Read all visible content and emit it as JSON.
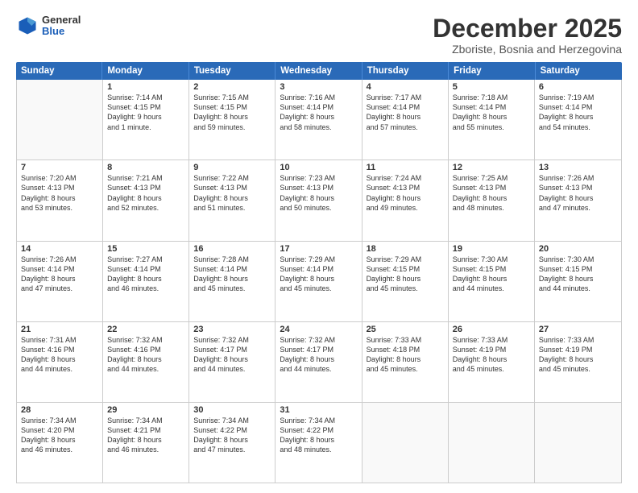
{
  "header": {
    "logo_general": "General",
    "logo_blue": "Blue",
    "main_title": "December 2025",
    "subtitle": "Zboriste, Bosnia and Herzegovina"
  },
  "days_of_week": [
    "Sunday",
    "Monday",
    "Tuesday",
    "Wednesday",
    "Thursday",
    "Friday",
    "Saturday"
  ],
  "weeks": [
    [
      {
        "day": "",
        "lines": []
      },
      {
        "day": "1",
        "lines": [
          "Sunrise: 7:14 AM",
          "Sunset: 4:15 PM",
          "Daylight: 9 hours",
          "and 1 minute."
        ]
      },
      {
        "day": "2",
        "lines": [
          "Sunrise: 7:15 AM",
          "Sunset: 4:15 PM",
          "Daylight: 8 hours",
          "and 59 minutes."
        ]
      },
      {
        "day": "3",
        "lines": [
          "Sunrise: 7:16 AM",
          "Sunset: 4:14 PM",
          "Daylight: 8 hours",
          "and 58 minutes."
        ]
      },
      {
        "day": "4",
        "lines": [
          "Sunrise: 7:17 AM",
          "Sunset: 4:14 PM",
          "Daylight: 8 hours",
          "and 57 minutes."
        ]
      },
      {
        "day": "5",
        "lines": [
          "Sunrise: 7:18 AM",
          "Sunset: 4:14 PM",
          "Daylight: 8 hours",
          "and 55 minutes."
        ]
      },
      {
        "day": "6",
        "lines": [
          "Sunrise: 7:19 AM",
          "Sunset: 4:14 PM",
          "Daylight: 8 hours",
          "and 54 minutes."
        ]
      }
    ],
    [
      {
        "day": "7",
        "lines": [
          "Sunrise: 7:20 AM",
          "Sunset: 4:13 PM",
          "Daylight: 8 hours",
          "and 53 minutes."
        ]
      },
      {
        "day": "8",
        "lines": [
          "Sunrise: 7:21 AM",
          "Sunset: 4:13 PM",
          "Daylight: 8 hours",
          "and 52 minutes."
        ]
      },
      {
        "day": "9",
        "lines": [
          "Sunrise: 7:22 AM",
          "Sunset: 4:13 PM",
          "Daylight: 8 hours",
          "and 51 minutes."
        ]
      },
      {
        "day": "10",
        "lines": [
          "Sunrise: 7:23 AM",
          "Sunset: 4:13 PM",
          "Daylight: 8 hours",
          "and 50 minutes."
        ]
      },
      {
        "day": "11",
        "lines": [
          "Sunrise: 7:24 AM",
          "Sunset: 4:13 PM",
          "Daylight: 8 hours",
          "and 49 minutes."
        ]
      },
      {
        "day": "12",
        "lines": [
          "Sunrise: 7:25 AM",
          "Sunset: 4:13 PM",
          "Daylight: 8 hours",
          "and 48 minutes."
        ]
      },
      {
        "day": "13",
        "lines": [
          "Sunrise: 7:26 AM",
          "Sunset: 4:13 PM",
          "Daylight: 8 hours",
          "and 47 minutes."
        ]
      }
    ],
    [
      {
        "day": "14",
        "lines": [
          "Sunrise: 7:26 AM",
          "Sunset: 4:14 PM",
          "Daylight: 8 hours",
          "and 47 minutes."
        ]
      },
      {
        "day": "15",
        "lines": [
          "Sunrise: 7:27 AM",
          "Sunset: 4:14 PM",
          "Daylight: 8 hours",
          "and 46 minutes."
        ]
      },
      {
        "day": "16",
        "lines": [
          "Sunrise: 7:28 AM",
          "Sunset: 4:14 PM",
          "Daylight: 8 hours",
          "and 45 minutes."
        ]
      },
      {
        "day": "17",
        "lines": [
          "Sunrise: 7:29 AM",
          "Sunset: 4:14 PM",
          "Daylight: 8 hours",
          "and 45 minutes."
        ]
      },
      {
        "day": "18",
        "lines": [
          "Sunrise: 7:29 AM",
          "Sunset: 4:15 PM",
          "Daylight: 8 hours",
          "and 45 minutes."
        ]
      },
      {
        "day": "19",
        "lines": [
          "Sunrise: 7:30 AM",
          "Sunset: 4:15 PM",
          "Daylight: 8 hours",
          "and 44 minutes."
        ]
      },
      {
        "day": "20",
        "lines": [
          "Sunrise: 7:30 AM",
          "Sunset: 4:15 PM",
          "Daylight: 8 hours",
          "and 44 minutes."
        ]
      }
    ],
    [
      {
        "day": "21",
        "lines": [
          "Sunrise: 7:31 AM",
          "Sunset: 4:16 PM",
          "Daylight: 8 hours",
          "and 44 minutes."
        ]
      },
      {
        "day": "22",
        "lines": [
          "Sunrise: 7:32 AM",
          "Sunset: 4:16 PM",
          "Daylight: 8 hours",
          "and 44 minutes."
        ]
      },
      {
        "day": "23",
        "lines": [
          "Sunrise: 7:32 AM",
          "Sunset: 4:17 PM",
          "Daylight: 8 hours",
          "and 44 minutes."
        ]
      },
      {
        "day": "24",
        "lines": [
          "Sunrise: 7:32 AM",
          "Sunset: 4:17 PM",
          "Daylight: 8 hours",
          "and 44 minutes."
        ]
      },
      {
        "day": "25",
        "lines": [
          "Sunrise: 7:33 AM",
          "Sunset: 4:18 PM",
          "Daylight: 8 hours",
          "and 45 minutes."
        ]
      },
      {
        "day": "26",
        "lines": [
          "Sunrise: 7:33 AM",
          "Sunset: 4:19 PM",
          "Daylight: 8 hours",
          "and 45 minutes."
        ]
      },
      {
        "day": "27",
        "lines": [
          "Sunrise: 7:33 AM",
          "Sunset: 4:19 PM",
          "Daylight: 8 hours",
          "and 45 minutes."
        ]
      }
    ],
    [
      {
        "day": "28",
        "lines": [
          "Sunrise: 7:34 AM",
          "Sunset: 4:20 PM",
          "Daylight: 8 hours",
          "and 46 minutes."
        ]
      },
      {
        "day": "29",
        "lines": [
          "Sunrise: 7:34 AM",
          "Sunset: 4:21 PM",
          "Daylight: 8 hours",
          "and 46 minutes."
        ]
      },
      {
        "day": "30",
        "lines": [
          "Sunrise: 7:34 AM",
          "Sunset: 4:22 PM",
          "Daylight: 8 hours",
          "and 47 minutes."
        ]
      },
      {
        "day": "31",
        "lines": [
          "Sunrise: 7:34 AM",
          "Sunset: 4:22 PM",
          "Daylight: 8 hours",
          "and 48 minutes."
        ]
      },
      {
        "day": "",
        "lines": []
      },
      {
        "day": "",
        "lines": []
      },
      {
        "day": "",
        "lines": []
      }
    ]
  ]
}
